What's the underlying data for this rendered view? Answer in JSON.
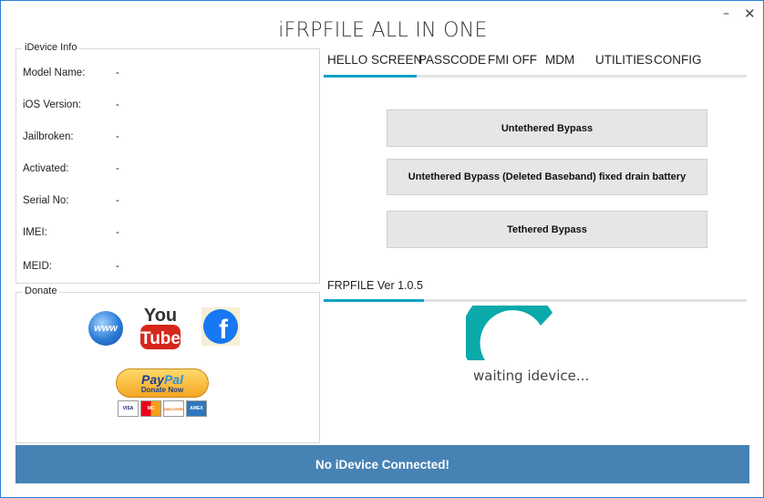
{
  "window": {
    "title": "iFRPFILE ALL IN ONE",
    "minimize_glyph": "–",
    "close_glyph": "✕"
  },
  "idevice_info": {
    "legend": "iDevice Info",
    "rows": [
      {
        "label": "Model Name:",
        "value": "-"
      },
      {
        "label": "iOS Version:",
        "value": "-"
      },
      {
        "label": "Jailbroken:",
        "value": "-"
      },
      {
        "label": "Activated:",
        "value": "-"
      },
      {
        "label": "Serial No:",
        "value": "-"
      },
      {
        "label": "IMEI:",
        "value": "-"
      },
      {
        "label": "MEID:",
        "value": "-"
      }
    ]
  },
  "donate": {
    "legend": "Donate",
    "www_text": "www",
    "youtube_top": "You",
    "youtube_bottom": "Tube",
    "facebook_letter": "f",
    "paypal_logo_a": "Pay",
    "paypal_logo_b": "Pal",
    "paypal_sub": "Donate Now",
    "cards": [
      "VISA",
      "MC",
      "DISCOVER",
      "AMEX"
    ],
    "icons": [
      "www-globe-icon",
      "youtube-icon",
      "facebook-icon",
      "paypal-donate-icon",
      "credit-cards-icon"
    ]
  },
  "tabs": [
    {
      "label": "HELLO SCREEN",
      "active": true
    },
    {
      "label": "PASSCODE",
      "active": false
    },
    {
      "label": "FMI OFF",
      "active": false
    },
    {
      "label": "MDM",
      "active": false
    },
    {
      "label": "UTILITIES",
      "active": false
    },
    {
      "label": "CONFIG",
      "active": false
    }
  ],
  "actions": {
    "untethered": "Untethered Bypass",
    "untethered_baseband": "Untethered Bypass (Deleted Baseband) fixed drain battery",
    "tethered": "Tethered Bypass"
  },
  "version": {
    "label": "FRPFILE Ver 1.0.5"
  },
  "progress": {
    "waiting_text": "waiting idevice...",
    "spinner_color": "#0aa9aa"
  },
  "status_bar": {
    "text": "No iDevice Connected!",
    "background": "#4682b4"
  },
  "colors": {
    "accent": "#11a0c6",
    "button_bg": "#e6e6e6"
  }
}
